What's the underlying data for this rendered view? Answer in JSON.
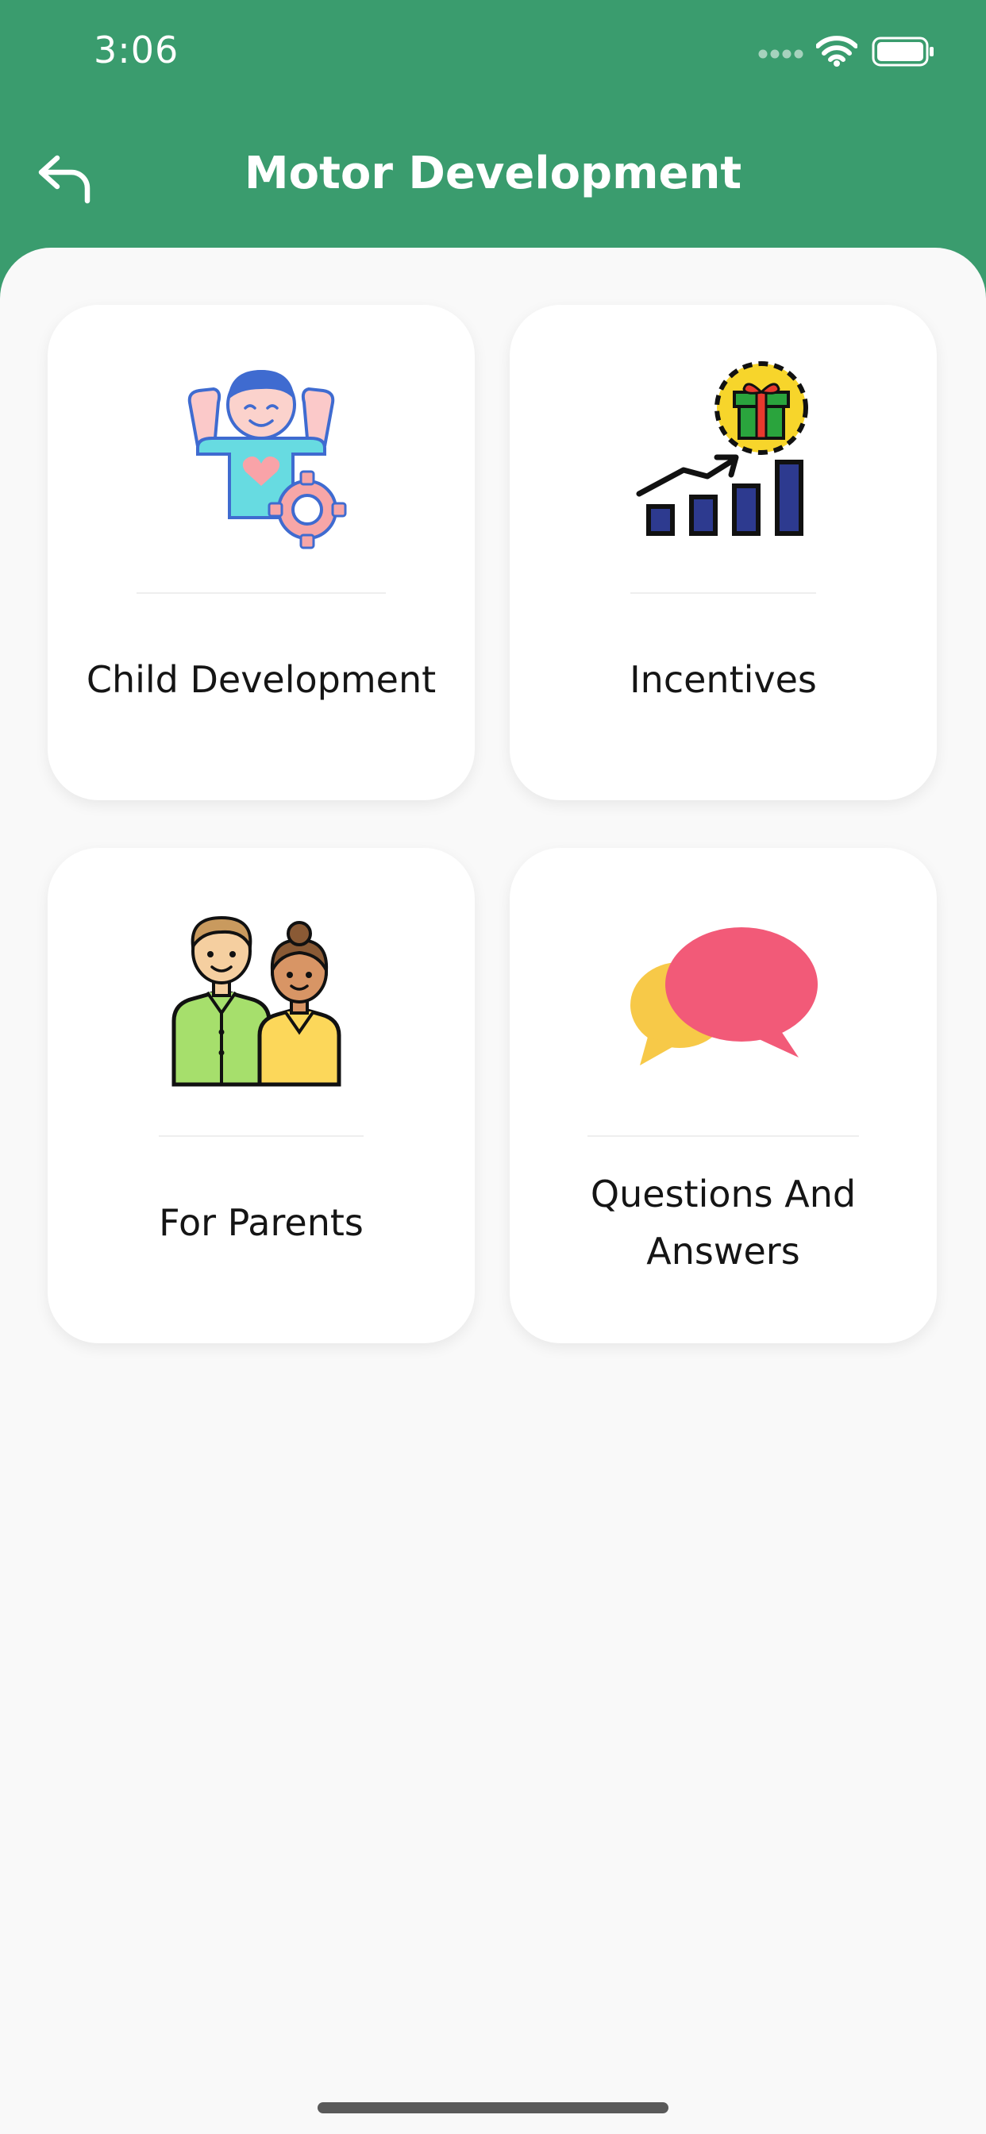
{
  "status_bar": {
    "time": "3:06",
    "icons": [
      "cellular-signal-icon",
      "wifi-icon",
      "battery-icon"
    ]
  },
  "header": {
    "title": "Motor Development",
    "back_icon": "back-arrow-icon",
    "background_color": "#3a9c6e"
  },
  "cards": [
    {
      "label": "Child Development",
      "icon": "child-development-icon"
    },
    {
      "label": "Incentives",
      "icon": "incentives-chart-icon"
    },
    {
      "label": "For Parents",
      "icon": "parents-icon"
    },
    {
      "label": "Questions And Answers",
      "icon": "qa-bubbles-icon"
    }
  ],
  "colors": {
    "accent": "#3a9c6e",
    "content_background": "#f9f9f9",
    "card_background": "#ffffff"
  }
}
